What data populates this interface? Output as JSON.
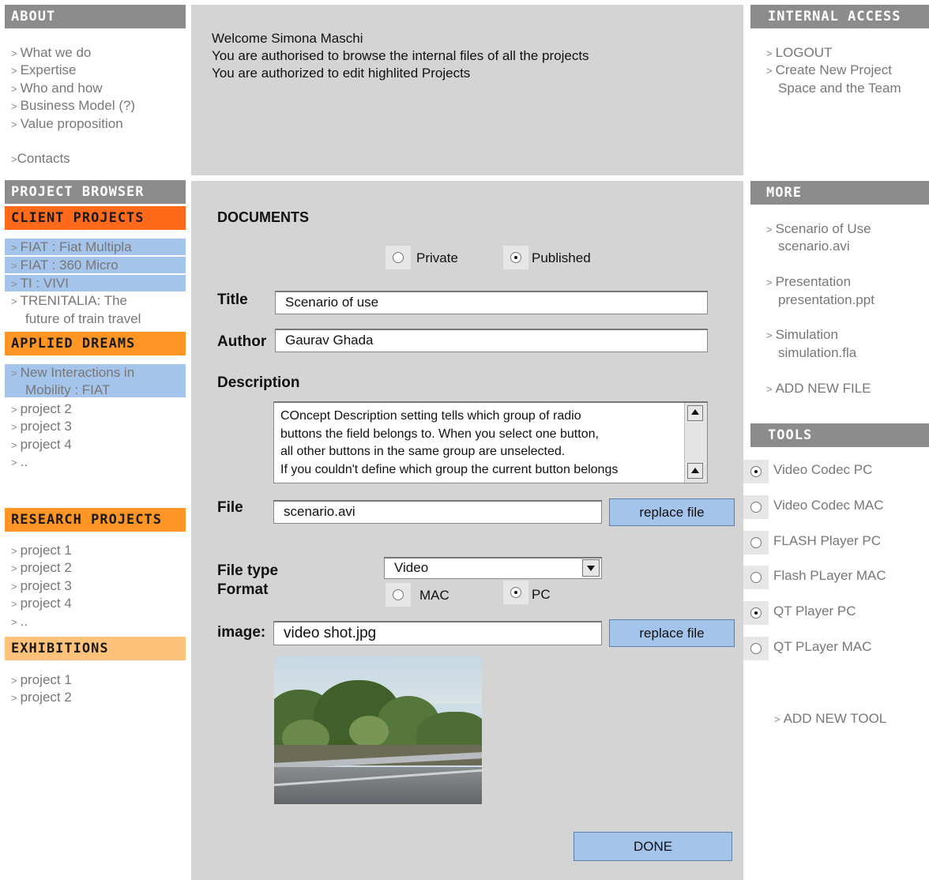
{
  "about": {
    "header": "ABOUT",
    "links": [
      "What we do",
      "Expertise",
      "Who and how",
      "Business Model (?)",
      "Value proposition"
    ],
    "contacts": "Contacts"
  },
  "welcome": {
    "line1": "Welcome Simona Maschi",
    "line2": "You are authorised to browse the internal files of all the projects",
    "line3": "You are authorized to edit highlited Projects"
  },
  "internal": {
    "header": "INTERNAL ACCESS",
    "logout": "LOGOUT",
    "create_line1": "Create New Project",
    "create_line2": "Space and the Team"
  },
  "project_browser": {
    "header": "PROJECT BROWSER",
    "client": {
      "header": "CLIENT PROJECTS",
      "items": [
        "FIAT : Fiat Multipla",
        "FIAT : 360 Micro",
        "TI : VIVI",
        "TRENITALIA: The"
      ],
      "item4_cont": "future of train travel"
    },
    "applied": {
      "header": "APPLIED DREAMS",
      "item1_line1": "New Interactions in",
      "item1_line2": "Mobility : FIAT",
      "items": [
        "project 2",
        "project 3",
        "project 4",
        ".."
      ]
    },
    "research": {
      "header": "RESEARCH PROJECTS",
      "items": [
        "project 1",
        "project 2",
        "project 3",
        "project 4",
        ".."
      ]
    },
    "exhibitions": {
      "header": "EXHIBITIONS",
      "items": [
        "project 1",
        "project 2"
      ]
    }
  },
  "documents": {
    "heading": "DOCUMENTS",
    "visibility": {
      "private": "Private",
      "published": "Published",
      "selected": "Published"
    },
    "title_label": "Title",
    "title_value": "Scenario of use",
    "author_label": "Author",
    "author_value": "Gaurav Ghada",
    "description_label": "Description",
    "description_lines": [
      "COncept Description setting tells which group of radio",
      "buttons the field belongs to. When you select one button,",
      "all other buttons in the same group are unselected.",
      "If you couldn't define which group the current button belongs"
    ],
    "file_label": "File",
    "file_value": "scenario.avi",
    "replace_label": "replace file",
    "file_type_label": "File type",
    "file_type_value": "Video",
    "format_label": "Format",
    "format": {
      "mac": "MAC",
      "pc": "PC",
      "selected": "PC"
    },
    "image_label": "image:",
    "image_value": "video shot.jpg",
    "image_replace_label": "replace file",
    "done_label": "DONE"
  },
  "more": {
    "header": "MORE",
    "files": [
      {
        "name": "Scenario of Use",
        "file": "scenario.avi"
      },
      {
        "name": "Presentation",
        "file": "presentation.ppt"
      },
      {
        "name": "Simulation",
        "file": "simulation.fla"
      }
    ],
    "add_file": "ADD NEW FILE"
  },
  "tools": {
    "header": "TOOLS",
    "items": [
      {
        "label": "Video Codec PC",
        "selected": true
      },
      {
        "label": "Video Codec MAC",
        "selected": false
      },
      {
        "label": "FLASH Player PC",
        "selected": false
      },
      {
        "label": "Flash PLayer MAC",
        "selected": false
      },
      {
        "label": "QT Player PC",
        "selected": true
      },
      {
        "label": "QT PLayer MAC",
        "selected": false
      }
    ],
    "add_tool": "ADD NEW TOOL"
  },
  "colors": {
    "header_gray": "#8c8c8c",
    "client_red": "#ff6a1a",
    "applied_orange": "#ff9524",
    "research_orange": "#ff9524",
    "exhibitions_peach": "#ffc27a",
    "highlight_blue": "#a4c4ec",
    "panel_gray": "#d4d4d4"
  }
}
